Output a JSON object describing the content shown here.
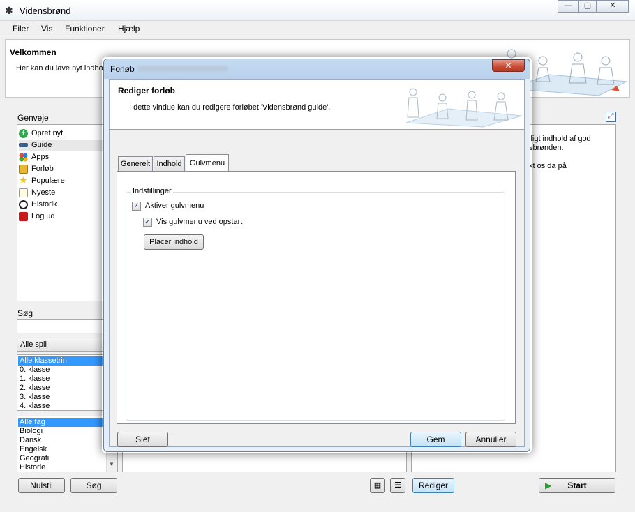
{
  "window": {
    "title": "Vidensbrønd",
    "minimize_glyph": "—",
    "maximize_glyph": "▢",
    "close_glyph": "✕"
  },
  "menu": [
    "Filer",
    "Vis",
    "Funktioner",
    "Hjælp"
  ],
  "welcome": {
    "title": "Velkommen",
    "text": "Her kan du lave nyt indhold"
  },
  "sidebar": {
    "title": "Genveje",
    "items": [
      {
        "label": "Opret nyt",
        "icon": "plus-circle-icon",
        "color": "#2ea84a"
      },
      {
        "label": "Guide",
        "icon": "signpost-icon",
        "color": "#3b5f8a"
      },
      {
        "label": "Apps",
        "icon": "apps-icon",
        "color": "#d94c3b"
      },
      {
        "label": "Forløb",
        "icon": "folder-icon",
        "color": "#e8b830"
      },
      {
        "label": "Populære",
        "icon": "star-icon",
        "color": "#f2c319"
      },
      {
        "label": "Nyeste",
        "icon": "new-page-icon",
        "color": "#f5e16a"
      },
      {
        "label": "Historik",
        "icon": "clock-icon",
        "color": "#222222"
      },
      {
        "label": "Log ud",
        "icon": "logout-icon",
        "color": "#c8191b"
      }
    ]
  },
  "search": {
    "title": "Søg",
    "value": "",
    "game_filter": "Alle spil",
    "grade_list": [
      "Alle klassetrin",
      "0. klasse",
      "1. klasse",
      "2. klasse",
      "3. klasse",
      "4. klasse"
    ],
    "subject_list": [
      "Alle fag",
      "Biologi",
      "Dansk",
      "Engelsk",
      "Geografi",
      "Historie"
    ],
    "reset_label": "Nulstil",
    "search_label": "Søg"
  },
  "right_panel": {
    "lines": [
      "lligt indhold af god",
      "sbrønden.",
      "",
      "kt os da på"
    ]
  },
  "bottom": {
    "edit_label": "Rediger",
    "start_label": "Start"
  },
  "dialog": {
    "title": "Forløb",
    "header_title": "Rediger forløb",
    "header_text": "I dette vindue kan du redigere forløbet 'Vidensbrønd guide'.",
    "tabs": [
      "Generelt",
      "Indhold",
      "Gulvmenu"
    ],
    "group_title": "Indstillinger",
    "check_enable": "Aktiver gulvmenu",
    "check_startup": "Vis gulvmenu ved opstart",
    "place_content": "Placer indhold",
    "delete_label": "Slet",
    "save_label": "Gem",
    "cancel_label": "Annuller",
    "close_glyph": "✕"
  },
  "colors": {
    "selection": "#3399ff",
    "accent": "#3c7fb1",
    "start_arrow": "#2e9b2e"
  }
}
